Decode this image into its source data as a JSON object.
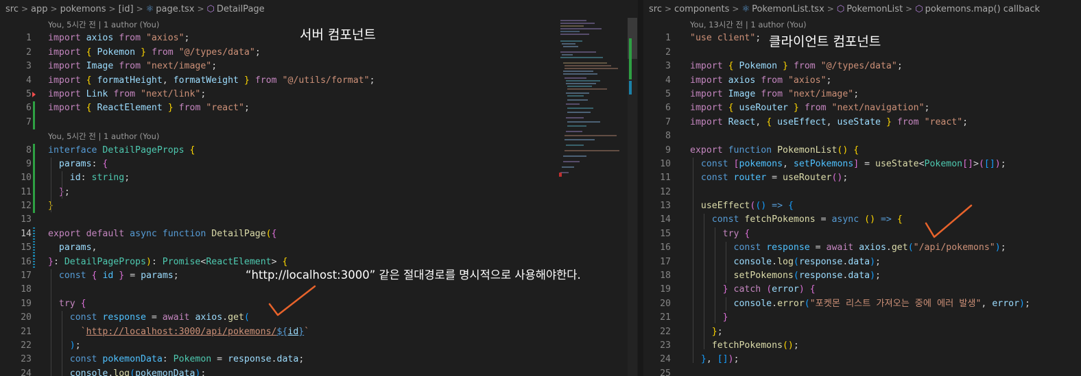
{
  "left": {
    "breadcrumb": [
      "src",
      "app",
      "pokemons",
      "[id]",
      "page.tsx",
      "DetailPage"
    ],
    "blame1": "You, 5시간 전 | 1 author (You)",
    "blame2": "You, 5시간 전 | 1 author (You)",
    "annotation_title": "서버 컴포넌트",
    "annotation_note": "“http://localhost:3000” 같은 절대경로를 명시적으로 사용해야한다.",
    "line_numbers": [
      "1",
      "2",
      "3",
      "4",
      "5",
      "6",
      "7",
      "8",
      "9",
      "10",
      "11",
      "12",
      "13",
      "14",
      "15",
      "16",
      "17",
      "18",
      "19",
      "20",
      "21",
      "22",
      "23",
      "24"
    ]
  },
  "right": {
    "breadcrumb": [
      "src",
      "components",
      "PokemonList.tsx",
      "PokemonList",
      "pokemons.map() callback"
    ],
    "blame": "You, 13시간 전 | 1 author (You)",
    "annotation_title": "클라이언트 컴포넌트",
    "line_numbers": [
      "1",
      "2",
      "3",
      "4",
      "5",
      "6",
      "7",
      "8",
      "9",
      "10",
      "11",
      "12",
      "13",
      "14",
      "15",
      "16",
      "17",
      "18",
      "19",
      "20",
      "21",
      "22",
      "23",
      "24",
      "25"
    ]
  },
  "colors": {
    "keyword": "#c586c0",
    "storage": "#569cd6",
    "string": "#ce9178",
    "variable": "#9cdcfe",
    "function": "#dcdcaa",
    "type": "#4ec9b0",
    "check_mark": "#e8632b"
  },
  "icons": [
    "react-file-icon",
    "symbol-method-icon",
    "chevron-right-icon",
    "red-check-mark"
  ]
}
